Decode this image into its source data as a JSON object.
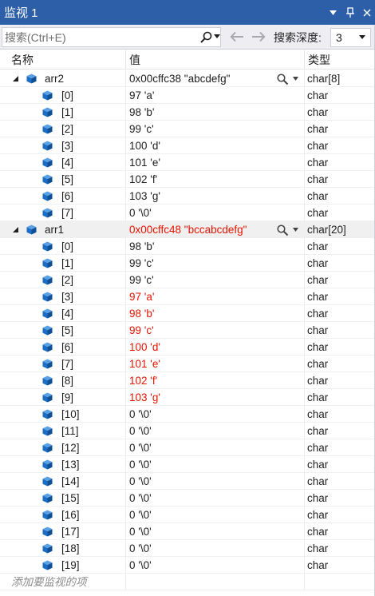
{
  "window": {
    "title": "监视 1",
    "dropdown_glyph": "▾",
    "pin_glyph": "📌",
    "close_glyph": "✕"
  },
  "toolbar": {
    "search_placeholder": "搜索(Ctrl+E)",
    "depth_label": "搜索深度:",
    "depth_value": "3"
  },
  "columns": {
    "name": "名称",
    "value": "值",
    "type": "类型"
  },
  "colors": {
    "title_bg": "#2d5fa8",
    "changed_value": "#e51400",
    "cube_blue": "#1c6ec5"
  },
  "watch_items": [
    {
      "name": "arr2",
      "value": "0x00cffc38 \"abcdefg\"",
      "type": "char[8]",
      "changed": false,
      "children": [
        {
          "name": "[0]",
          "value": "97 'a'",
          "type": "char",
          "changed": false
        },
        {
          "name": "[1]",
          "value": "98 'b'",
          "type": "char",
          "changed": false
        },
        {
          "name": "[2]",
          "value": "99 'c'",
          "type": "char",
          "changed": false
        },
        {
          "name": "[3]",
          "value": "100 'd'",
          "type": "char",
          "changed": false
        },
        {
          "name": "[4]",
          "value": "101 'e'",
          "type": "char",
          "changed": false
        },
        {
          "name": "[5]",
          "value": "102 'f'",
          "type": "char",
          "changed": false
        },
        {
          "name": "[6]",
          "value": "103 'g'",
          "type": "char",
          "changed": false
        },
        {
          "name": "[7]",
          "value": "0 '\\0'",
          "type": "char",
          "changed": false
        }
      ]
    },
    {
      "name": "arr1",
      "value": "0x00cffc48 \"bccabcdefg\"",
      "type": "char[20]",
      "changed": true,
      "selected": true,
      "children": [
        {
          "name": "[0]",
          "value": "98 'b'",
          "type": "char",
          "changed": false
        },
        {
          "name": "[1]",
          "value": "99 'c'",
          "type": "char",
          "changed": false
        },
        {
          "name": "[2]",
          "value": "99 'c'",
          "type": "char",
          "changed": false
        },
        {
          "name": "[3]",
          "value": "97 'a'",
          "type": "char",
          "changed": true
        },
        {
          "name": "[4]",
          "value": "98 'b'",
          "type": "char",
          "changed": true
        },
        {
          "name": "[5]",
          "value": "99 'c'",
          "type": "char",
          "changed": true
        },
        {
          "name": "[6]",
          "value": "100 'd'",
          "type": "char",
          "changed": true
        },
        {
          "name": "[7]",
          "value": "101 'e'",
          "type": "char",
          "changed": true
        },
        {
          "name": "[8]",
          "value": "102 'f'",
          "type": "char",
          "changed": true
        },
        {
          "name": "[9]",
          "value": "103 'g'",
          "type": "char",
          "changed": true
        },
        {
          "name": "[10]",
          "value": "0 '\\0'",
          "type": "char",
          "changed": false
        },
        {
          "name": "[11]",
          "value": "0 '\\0'",
          "type": "char",
          "changed": false
        },
        {
          "name": "[12]",
          "value": "0 '\\0'",
          "type": "char",
          "changed": false
        },
        {
          "name": "[13]",
          "value": "0 '\\0'",
          "type": "char",
          "changed": false
        },
        {
          "name": "[14]",
          "value": "0 '\\0'",
          "type": "char",
          "changed": false
        },
        {
          "name": "[15]",
          "value": "0 '\\0'",
          "type": "char",
          "changed": false
        },
        {
          "name": "[16]",
          "value": "0 '\\0'",
          "type": "char",
          "changed": false
        },
        {
          "name": "[17]",
          "value": "0 '\\0'",
          "type": "char",
          "changed": false
        },
        {
          "name": "[18]",
          "value": "0 '\\0'",
          "type": "char",
          "changed": false
        },
        {
          "name": "[19]",
          "value": "0 '\\0'",
          "type": "char",
          "changed": false
        }
      ]
    }
  ],
  "add_watch_placeholder": "添加要监视的项"
}
